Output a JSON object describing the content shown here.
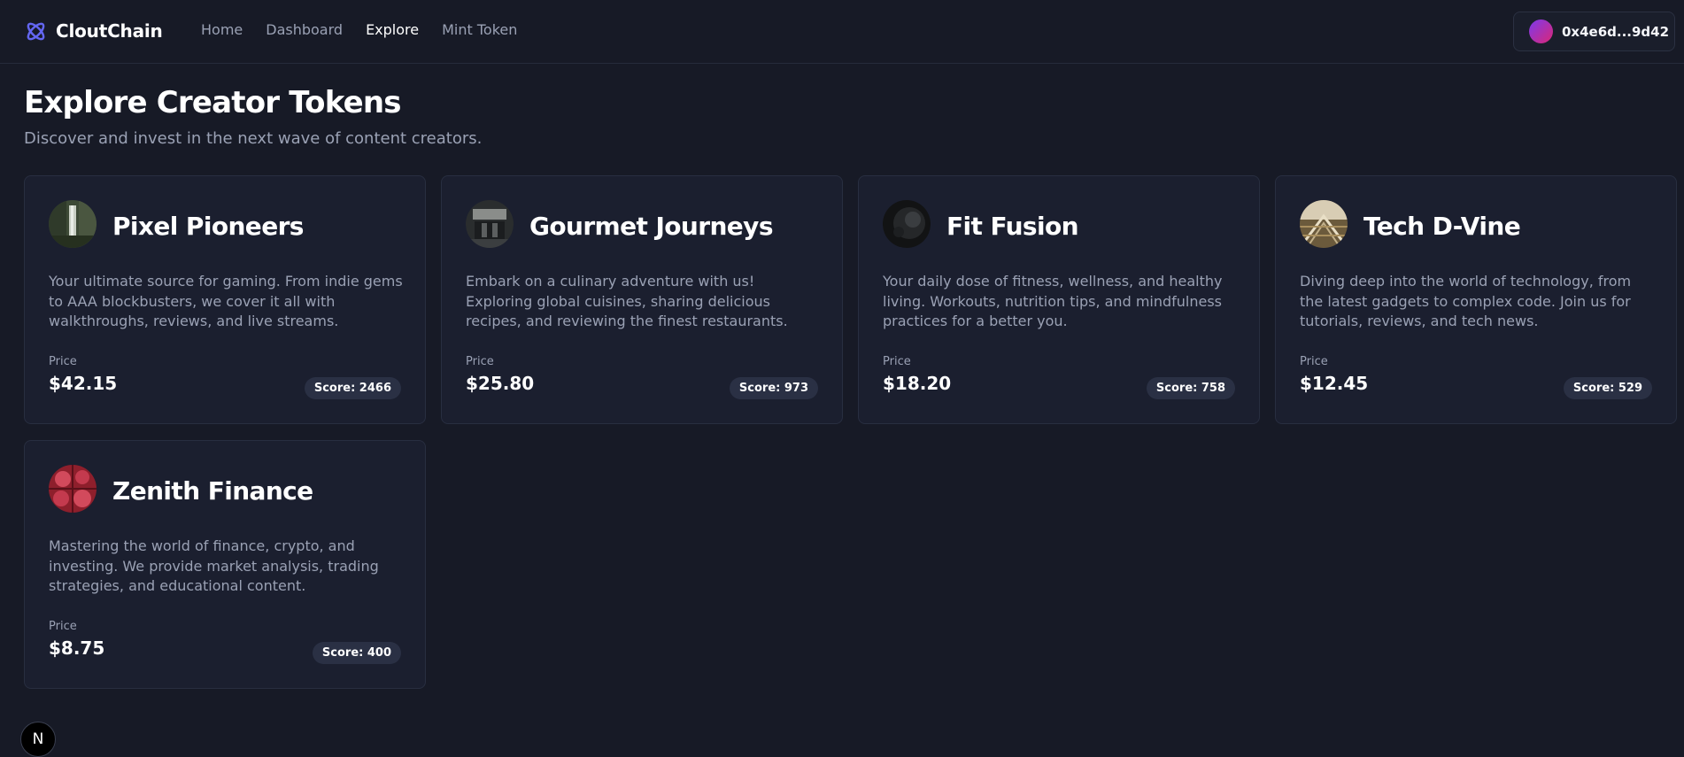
{
  "app": {
    "brand_name": "CloutChain",
    "accent_color": "#6366f1"
  },
  "nav": {
    "items": [
      {
        "label": "Home",
        "active": false
      },
      {
        "label": "Dashboard",
        "active": false
      },
      {
        "label": "Explore",
        "active": true
      },
      {
        "label": "Mint Token",
        "active": false
      }
    ]
  },
  "wallet": {
    "address": "0x4e6d...9d42",
    "avatar_icon": "gradient-avatar"
  },
  "page": {
    "title": "Explore Creator Tokens",
    "subtitle": "Discover and invest in the next wave of content creators."
  },
  "creators": [
    {
      "name": "Pixel Pioneers",
      "description": "Your ultimate source for gaming. From indie gems to AAA blockbusters, we cover it all with walkthroughs, reviews, and live streams.",
      "price_label": "Price",
      "price": "$42.15",
      "score": "Score: 2466",
      "avatar_icon": "waterfall-forest-photo"
    },
    {
      "name": "Gourmet Journeys",
      "description": "Embark on a culinary adventure with us! Exploring global cuisines, sharing delicious recipes, and reviewing the finest restaurants.",
      "price_label": "Price",
      "price": "$25.80",
      "score": "Score: 973",
      "avatar_icon": "interior-photo"
    },
    {
      "name": "Fit Fusion",
      "description": "Your daily dose of fitness, wellness, and healthy living. Workouts, nutrition tips, and mindfulness practices for a better you.",
      "price_label": "Price",
      "price": "$18.20",
      "score": "Score: 758",
      "avatar_icon": "dark-texture-photo"
    },
    {
      "name": "Tech D-Vine",
      "description": "Diving deep into the world of technology, from the latest gadgets to complex code. Join us for tutorials, reviews, and tech news.",
      "price_label": "Price",
      "price": "$12.45",
      "score": "Score: 529",
      "avatar_icon": "architecture-photo"
    },
    {
      "name": "Zenith Finance",
      "description": "Mastering the world of finance, crypto, and investing. We provide market analysis, trading strategies, and educational content.",
      "price_label": "Price",
      "price": "$8.75",
      "score": "Score: 400",
      "avatar_icon": "red-pattern-photo"
    }
  ],
  "dev_badge": {
    "label": "N"
  }
}
